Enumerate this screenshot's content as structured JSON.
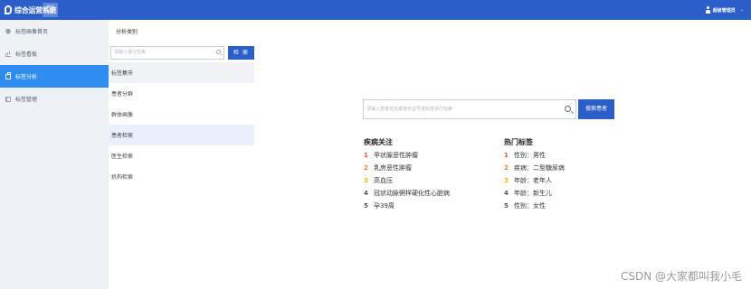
{
  "header": {
    "app_title": "综合运营系统",
    "badge_line1": "测试",
    "badge_line2": "系统",
    "user_name": "超级管理员"
  },
  "sidebar": {
    "items": [
      {
        "label": "标签画像首页",
        "icon": "hexagon-icon"
      },
      {
        "label": "标签看板",
        "icon": "bar-chart-icon"
      },
      {
        "label": "标签分析",
        "icon": "briefcase-icon",
        "active": true
      },
      {
        "label": "标签管理",
        "icon": "book-icon"
      }
    ]
  },
  "subpanel": {
    "title": "分析类别",
    "search_placeholder": "请输入进行检索",
    "search_button": "检 索",
    "items": [
      "标签集市",
      "患者分群",
      "群体画像",
      "患者检索",
      "医生检索",
      "机构检索"
    ]
  },
  "main": {
    "search_placeholder": "请输入患者姓名或身份证号或标签进行检索",
    "search_button": "搜索患者",
    "disease_title": "疾病关注",
    "disease_list": [
      {
        "rank": "1",
        "label": "甲状腺恶性肿瘤"
      },
      {
        "rank": "2",
        "label": "乳房恶性肿瘤"
      },
      {
        "rank": "3",
        "label": "高血压"
      },
      {
        "rank": "4",
        "label": "冠状动脉粥样硬化性心脏病"
      },
      {
        "rank": "5",
        "label": "孕39周"
      }
    ],
    "tags_title": "热门标签",
    "tags_list": [
      {
        "rank": "1",
        "label": "性别：男性"
      },
      {
        "rank": "2",
        "label": "疾病：二型糖尿病"
      },
      {
        "rank": "3",
        "label": "年龄：老年人"
      },
      {
        "rank": "4",
        "label": "年龄：新生儿"
      },
      {
        "rank": "5",
        "label": "性别：女性"
      }
    ]
  },
  "watermark": "CSDN @大家都叫我小毛",
  "colors": {
    "header_bg": "#2b5ec9",
    "active_nav": "#2f8cf0",
    "rank1": "#e84b3c",
    "rank2": "#f07a20",
    "rank3": "#f0b400"
  }
}
